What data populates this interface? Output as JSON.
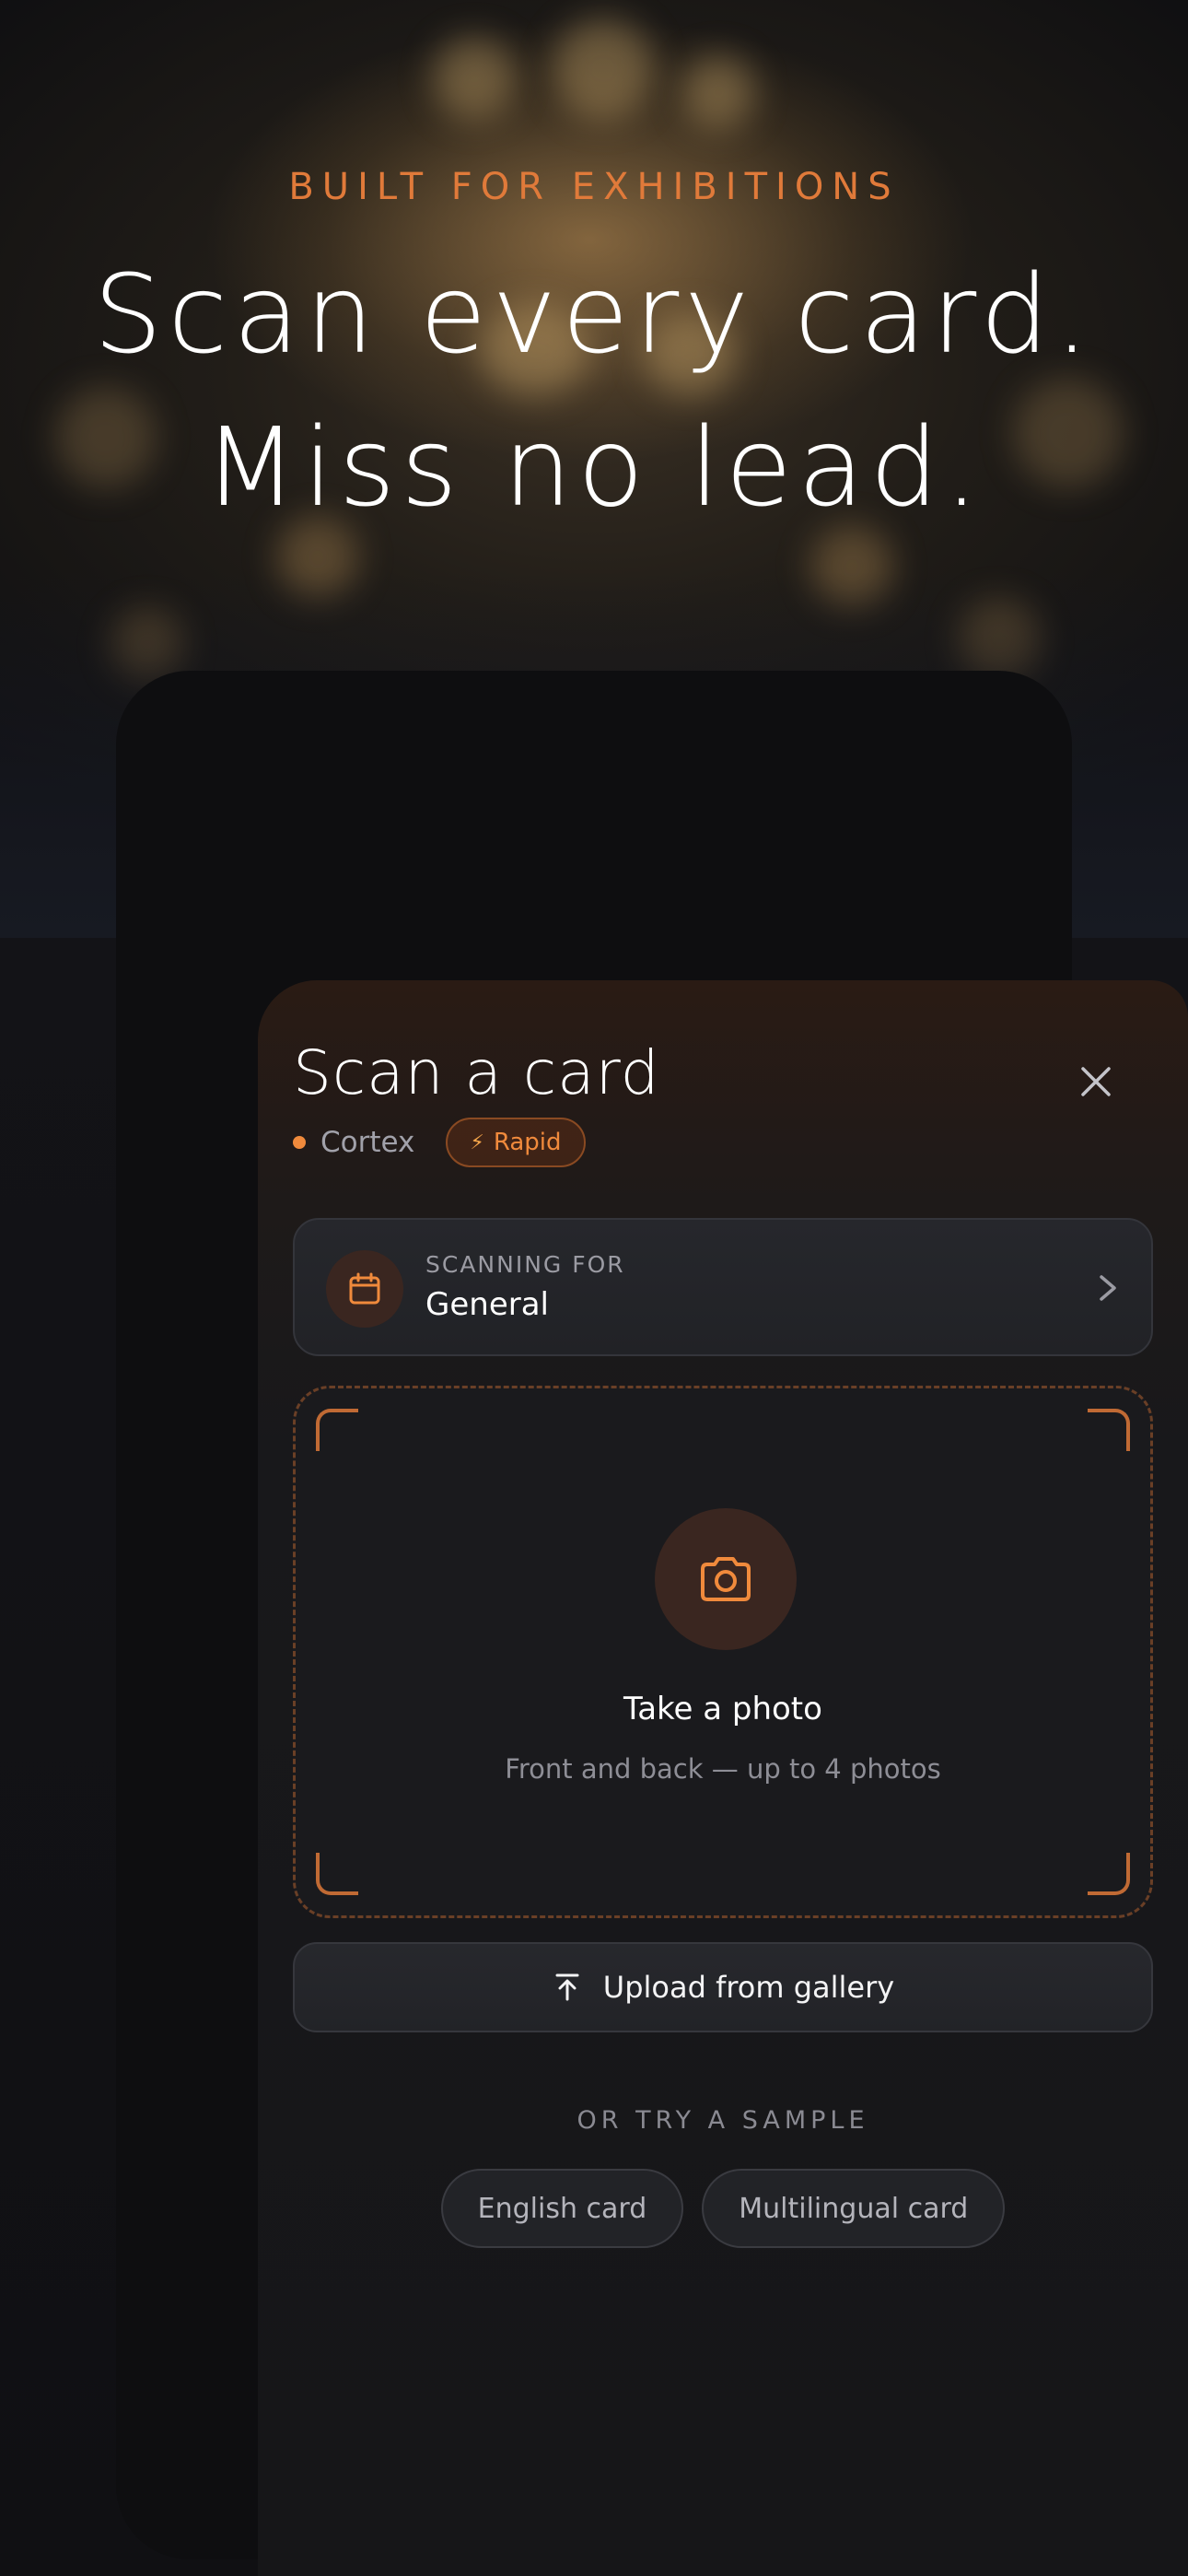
{
  "hero": {
    "eyebrow": "BUILT FOR EXHIBITIONS",
    "headline_line1": "Scan every card.",
    "headline_line2": "Miss no lead."
  },
  "sheet": {
    "title": "Scan a card",
    "close_icon": "close-icon",
    "brand": "Cortex",
    "brand_dot_color": "#f08a3c",
    "mode_badge": "Rapid",
    "mode_icon": "lightning-bolt-icon"
  },
  "scanning_for": {
    "label": "SCANNING FOR",
    "value": "General",
    "icon": "calendar-icon",
    "chevron": "chevron-right-icon"
  },
  "capture": {
    "icon": "camera-icon",
    "title": "Take a photo",
    "subtitle": "Front and back — up to 4 photos"
  },
  "upload": {
    "label": "Upload from gallery",
    "icon": "upload-icon"
  },
  "samples": {
    "heading": "OR TRY A SAMPLE",
    "items": [
      "English card",
      "Multilingual card"
    ]
  },
  "colors": {
    "accent": "#f08a3c",
    "background": "#101013",
    "surface": "#18181b"
  }
}
